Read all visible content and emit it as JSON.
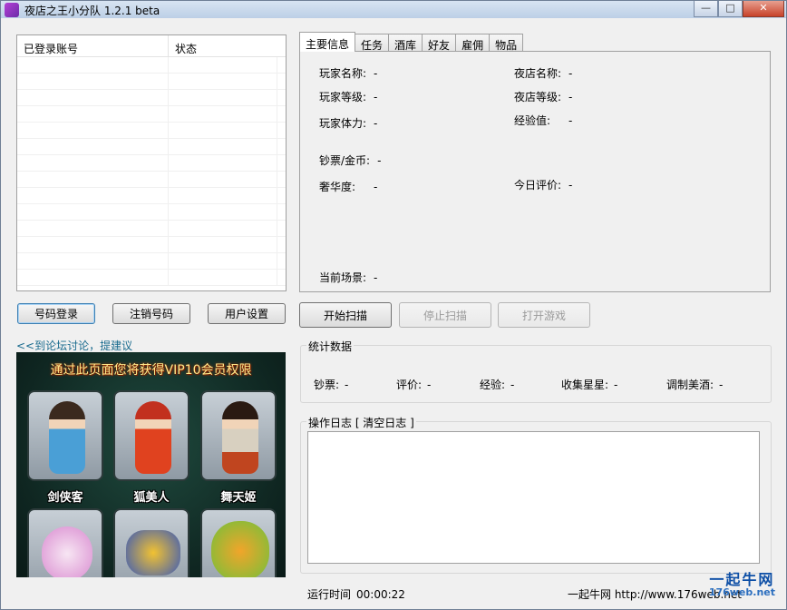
{
  "window": {
    "title": "夜店之王小分队 1.2.1 beta",
    "icon": "app-icon",
    "controls": {
      "minimize": "—",
      "maximize": "□",
      "close": "✕"
    }
  },
  "accounts": {
    "columns": [
      "已登录账号",
      "状态"
    ],
    "rows": []
  },
  "left_buttons": {
    "login": "号码登录",
    "logout": "注销号码",
    "settings": "用户设置"
  },
  "forum_link": "<<到论坛讨论，提建议",
  "ad": {
    "banner": "通过此页面您将获得VIP10会员权限",
    "captions": [
      "剑侠客",
      "狐美人",
      "舞天姬"
    ]
  },
  "tabs": [
    "主要信息",
    "任务",
    "酒库",
    "好友",
    "雇佣",
    "物品"
  ],
  "main_info": {
    "player_name": {
      "label": "玩家名称:",
      "value": "-"
    },
    "player_level": {
      "label": "玩家等级:",
      "value": "-"
    },
    "player_stamina": {
      "label": "玩家体力:",
      "value": "-"
    },
    "money": {
      "label": "钞票/金币:",
      "value": "-"
    },
    "luxury": {
      "label": "奢华度:",
      "value": "-"
    },
    "club_name": {
      "label": "夜店名称:",
      "value": "-"
    },
    "club_level": {
      "label": "夜店等级:",
      "value": "-"
    },
    "exp": {
      "label": "经验值:",
      "value": "-"
    },
    "today_rating": {
      "label": "今日评价:",
      "value": "-"
    },
    "current_scene": {
      "label": "当前场景:",
      "value": "-"
    }
  },
  "scan_buttons": {
    "start": "开始扫描",
    "stop": "停止扫描",
    "open_game": "打开游戏"
  },
  "stats": {
    "title": "统计数据",
    "items": [
      {
        "label": "钞票:",
        "value": "-"
      },
      {
        "label": "评价:",
        "value": "-"
      },
      {
        "label": "经验:",
        "value": "-"
      },
      {
        "label": "收集星星:",
        "value": "-"
      },
      {
        "label": "调制美酒:",
        "value": "-"
      }
    ]
  },
  "log": {
    "title": "操作日志 [ 清空日志 ]"
  },
  "status": {
    "runtime_label": "运行时间",
    "runtime_value": "00:00:22",
    "footer_link": "一起牛网 http://www.176web.net"
  },
  "watermark": {
    "line1": "一起牛网",
    "line2": "176web.net"
  },
  "colors": {
    "window_bg": "#f0f0f0",
    "link": "#1a6b8e",
    "accent_focus": "#3c7fb1"
  }
}
